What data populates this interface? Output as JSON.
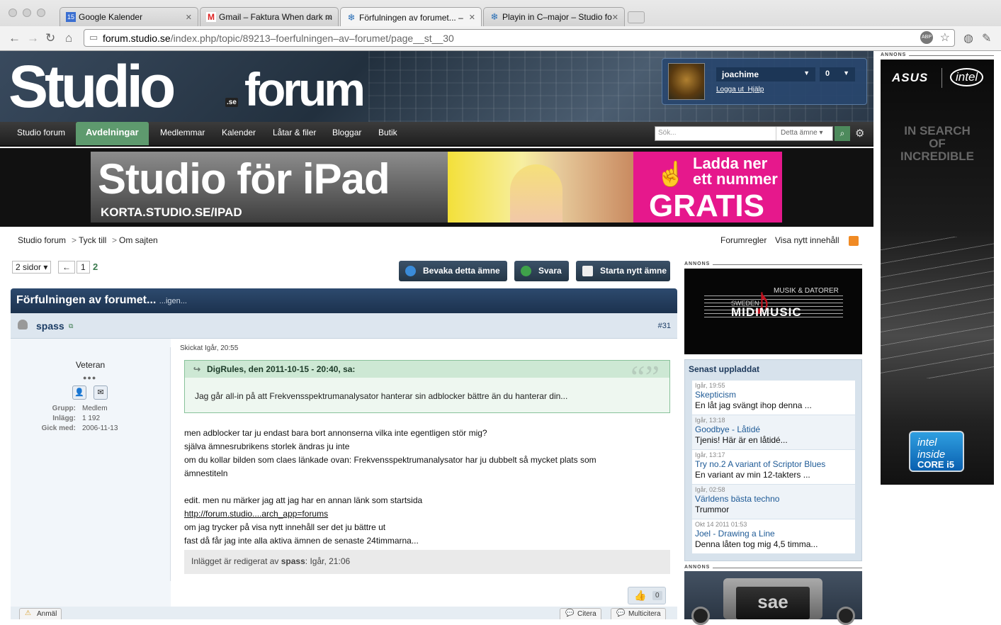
{
  "browser": {
    "tabs": [
      {
        "label": "Google Kalender",
        "icon_text": "15"
      },
      {
        "label": "Gmail – Faktura When dark m",
        "icon_text": "M"
      },
      {
        "label": "Förfulningen av forumet... – ",
        "icon_text": "❄"
      },
      {
        "label": "Playin in C–major – Studio fo",
        "icon_text": "❄"
      }
    ],
    "url_host": "forum.studio.se",
    "url_path": "/index.php/topic/89213–foerfulningen–av–forumet/page__st__30"
  },
  "header": {
    "logo_main": "Studio",
    "logo_forum": "forum",
    "logo_se": ".se",
    "username": "joachime",
    "notification_count": "0",
    "logout_label": "Logga ut",
    "help_label": "Hjälp"
  },
  "nav": {
    "items": [
      "Studio forum",
      "Avdelningar",
      "Medlemmar",
      "Kalender",
      "Låtar & filer",
      "Bloggar",
      "Butik"
    ],
    "search_placeholder": "Sök...",
    "search_scope": "Detta ämne"
  },
  "banner": {
    "title": "Studio för iPad",
    "url": "KORTA.STUDIO.SE/IPAD",
    "cta_line1": "Ladda ner",
    "cta_line2": "ett nummer",
    "cta_big": "GRATIS"
  },
  "breadcrumb": [
    "Studio forum",
    "Tyck till",
    "Om sajten"
  ],
  "top_links": [
    "Forumregler",
    "Visa nytt innehåll"
  ],
  "pagination": {
    "pages_label": "2 sidor",
    "prev": "←",
    "page1": "1",
    "current": "2"
  },
  "actions": [
    "Bevaka detta ämne",
    "Svara",
    "Starta nytt ämne"
  ],
  "topic": {
    "title": "Förfulningen av forumet...",
    "subtitle": "...igen..."
  },
  "post": {
    "author": "spass",
    "number": "#31",
    "rank": "Veteran",
    "group_label": "Grupp:",
    "group_value": "Medlem",
    "posts_label": "Inlägg:",
    "posts_value": "1 192",
    "joined_label": "Gick med:",
    "joined_value": "2006-11-13",
    "posted": "Skickat Igår, 20:55",
    "quote_header": "DigRules, den 2011-10-15 - 20:40, sa:",
    "quote_text": "Jag går all-in på att Frekvensspektrumanalysator hanterar sin adblocker bättre än du hanterar din...",
    "lines": [
      "men adblocker tar ju endast bara bort annonserna vilka inte egentligen stör mig?",
      "själva ämnesrubrikens storlek ändras ju inte",
      "om du kollar bilden som claes länkade ovan: Frekvensspektrumanalysator har ju dubbelt så mycket plats som",
      "ämnestiteln",
      "",
      "edit. men nu märker jag att jag har en annan länk som startsida",
      "http://forum.studio....arch_app=forums",
      "om jag trycker på visa nytt innehåll ser det ju bättre ut",
      "fast då får jag inte alla aktiva ämnen de senaste 24timmarna..."
    ],
    "edited_prefix": "Inlägget är redigerat av ",
    "edited_by": "spass",
    "edited_time": ": Igår, 21:06",
    "likes": "0",
    "report": "Anmäl",
    "quote_btn": "Citera",
    "multiquote_btn": "Multicitera"
  },
  "ads": {
    "label": "ANNONS",
    "midi_top": "MUSIK & DATORER",
    "midi_sweden": "SWEDEN",
    "midi_main": "MIDIMUSIC",
    "side_brand1": "ASUS",
    "side_brand2": "intel",
    "side_tag": "IN SEARCH OF INCREDIBLE",
    "side_chip1": "intel inside",
    "side_chip2": "CORE i5",
    "sae_text": "sae"
  },
  "latest": {
    "title": "Senast uppladdat",
    "items": [
      {
        "date": "Igår, 19:55",
        "title": "Skepticism",
        "snippet": "En låt jag svängt ihop denna ..."
      },
      {
        "date": "Igår, 13:18",
        "title": "Goodbye - Låtidé",
        "snippet": "Tjenis! Här är en låtidé..."
      },
      {
        "date": "Igår, 13:17",
        "title": "Try no.2 A variant of Scriptor Blues",
        "snippet": "En variant av min 12-takters ..."
      },
      {
        "date": "Igår, 02:58",
        "title": "Världens bästa techno",
        "snippet": "Trummor"
      },
      {
        "date": "Okt 14 2011 01:53",
        "title": "Joel - Drawing a Line",
        "snippet": "Denna låten tog mig 4,5 timma..."
      }
    ]
  },
  "colors": {
    "header_navy": "#1c324e",
    "nav_green": "#5e9a6e",
    "link_blue": "#1e5a96",
    "banner_pink": "#e6188c"
  }
}
